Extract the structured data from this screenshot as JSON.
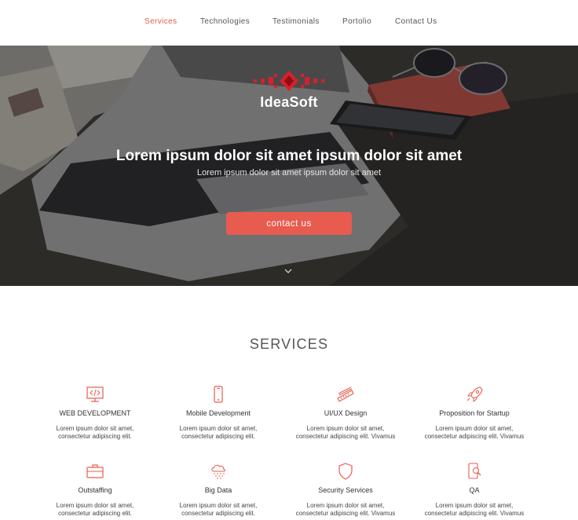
{
  "nav": {
    "items": [
      {
        "label": "Services",
        "active": true
      },
      {
        "label": "Technologies",
        "active": false
      },
      {
        "label": "Testimonials",
        "active": false
      },
      {
        "label": "Portolio",
        "active": false
      },
      {
        "label": "Contact Us",
        "active": false
      }
    ]
  },
  "hero": {
    "brand": "IdeaSoft",
    "headline": "Lorem ipsum dolor sit amet ipsum dolor sit amet",
    "subline": "Lorem ipsum dolor sit amet ipsum dolor sit amet",
    "cta_label": "contact us"
  },
  "services": {
    "title": "SERVICES",
    "items": [
      {
        "name": "WEB DEVELOPMENT",
        "desc": "Lorem ipsum dolor sit amet,\nconsectetur adipiscing elit.",
        "icon": "code-monitor-icon"
      },
      {
        "name": "Mobile Development",
        "desc": "Lorem ipsum dolor sit amet,\nconsectetur adipiscing elit.",
        "icon": "smartphone-icon"
      },
      {
        "name": "UI/UX Design",
        "desc": "Lorem ipsum dolor sit amet,\nconsectetur adipiscing elit. Vivamus",
        "icon": "ruler-pencil-icon"
      },
      {
        "name": "Proposition for Startup",
        "desc": "Lorem ipsum dolor sit amet,\nconsectetur adipiscing elit. Vivamus",
        "icon": "rocket-icon"
      },
      {
        "name": "Outstaffing",
        "desc": "Lorem ipsum dolor sit amet,\nconsectetur adipiscing elit.",
        "icon": "briefcase-icon"
      },
      {
        "name": "Big Data",
        "desc": "Lorem ipsum dolor sit amet,\nconsectetur adipiscing elit.",
        "icon": "cloud-data-icon"
      },
      {
        "name": "Security Services",
        "desc": "Lorem ipsum dolor sit amet,\nconsectetur adipiscing elit. Vivamus",
        "icon": "shield-icon"
      },
      {
        "name": "QA",
        "desc": "Lorem ipsum dolor sit amet,\nconsectetur adipiscing elit. Vivamus",
        "icon": "phone-search-icon"
      }
    ]
  },
  "colors": {
    "accent": "#e85c4f",
    "nav_active": "#e8574a"
  }
}
